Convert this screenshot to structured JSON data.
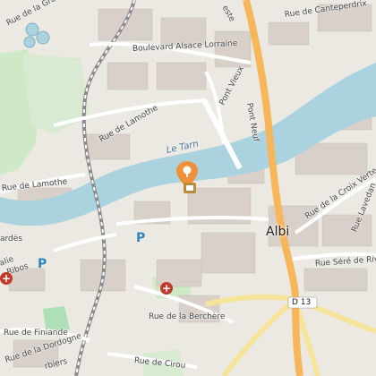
{
  "map": {
    "city": "Albi",
    "river": "Le Tarn",
    "road_ref": "D 13",
    "streets": {
      "gravieres": "Rue de la Gravière",
      "alsace": "Boulevard Alsace Lorraine",
      "canteperdrix": "Rue de Canteperdrix",
      "pont_vieux": "Pont Vieux",
      "pont_neuf": "Pont Neuf",
      "lamothe_1": "Rue de Lamothe",
      "lamothe_2": "Rue de Lamothe",
      "croix_verte": "Rue de la Croix Verte",
      "lavedan": "Rue Lavedan",
      "seree": "Rue Séré de Rivières",
      "berchere": "Rue de la Berchère",
      "finiande": "Rue de Finiande",
      "dordogne": "Rue de la Dordogne",
      "cirou": "Rue de Cirou",
      "ribos": "Ribos",
      "bardes": "ardès",
      "balie": "alie",
      "rbiers": "rbiers",
      "este": "este"
    },
    "parking_symbol": "P",
    "hospital_symbol": "+",
    "poi_icon": "location-marker",
    "colors": {
      "water": "#aad3df",
      "land": "#ece9e3",
      "primary_road": "#f7b65a",
      "secondary_road": "#f5e49a",
      "marker": "#f0903a",
      "hospital": "#c0392b",
      "parking": "#2e86c1"
    }
  }
}
